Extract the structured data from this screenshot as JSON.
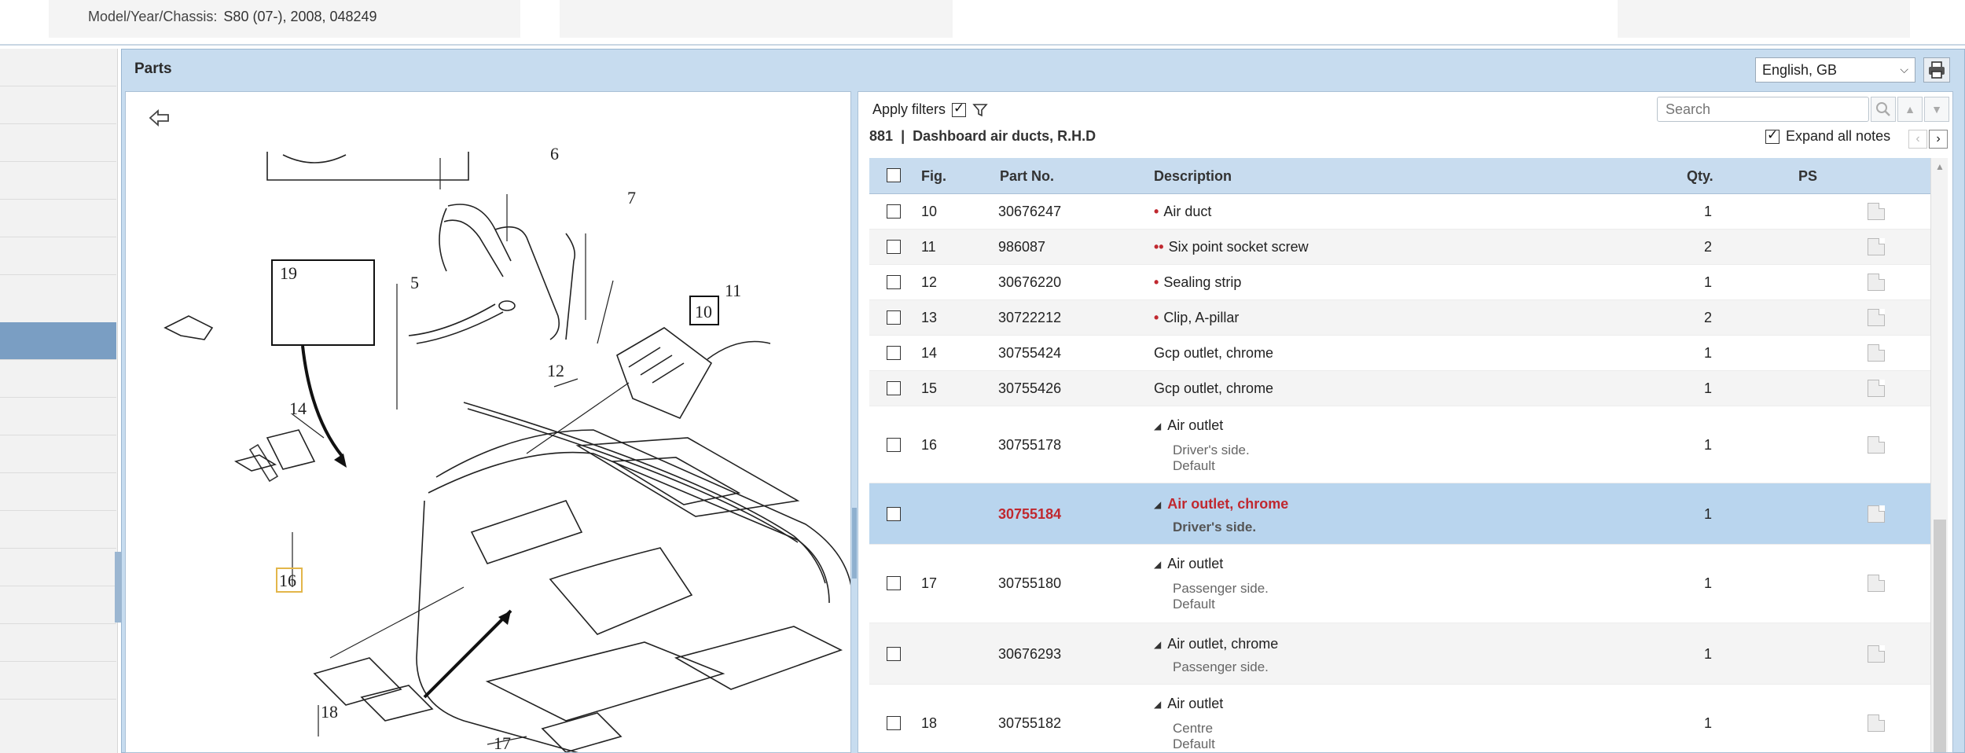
{
  "header": {
    "model_label": "Model/Year/Chassis:",
    "model_value": "S80 (07-), 2008, 048249"
  },
  "parts_panel": {
    "title": "Parts",
    "language": "English, GB"
  },
  "diagram": {
    "callouts": [
      "6",
      "7",
      "19",
      "5",
      "10",
      "11",
      "12",
      "14",
      "16",
      "18",
      "17"
    ]
  },
  "toolbar": {
    "apply_filters_label": "Apply filters",
    "apply_filters_checked": true,
    "group_number": "881",
    "group_separator": "|",
    "group_name": "Dashboard air ducts, R.H.D",
    "search_placeholder": "Search",
    "expand_notes_label": "Expand all notes",
    "expand_notes_checked": true
  },
  "table": {
    "headers": {
      "fig": "Fig.",
      "part_no": "Part No.",
      "description": "Description",
      "qty": "Qty.",
      "ps": "PS"
    },
    "rows": [
      {
        "fig": "10",
        "part_no": "30676247",
        "bullets": "•",
        "description": "Air duct",
        "qty": "1"
      },
      {
        "fig": "11",
        "part_no": "986087",
        "bullets": "••",
        "description": "Six point socket screw",
        "qty": "2"
      },
      {
        "fig": "12",
        "part_no": "30676220",
        "bullets": "•",
        "description": "Sealing strip",
        "qty": "1"
      },
      {
        "fig": "13",
        "part_no": "30722212",
        "bullets": "•",
        "description": "Clip, A-pillar",
        "qty": "2"
      },
      {
        "fig": "14",
        "part_no": "30755424",
        "bullets": "",
        "description": "Gcp outlet, chrome",
        "qty": "1"
      },
      {
        "fig": "15",
        "part_no": "30755426",
        "bullets": "",
        "description": "Gcp outlet, chrome",
        "qty": "1"
      },
      {
        "fig": "16",
        "part_no": "30755178",
        "description": "Air outlet",
        "sub1": "Driver's side.",
        "sub2": "Default",
        "qty": "1"
      },
      {
        "fig": "",
        "part_no": "30755184",
        "description": "Air outlet, chrome",
        "sub1": "Driver's side.",
        "qty": "1",
        "selected": true
      },
      {
        "fig": "17",
        "part_no": "30755180",
        "description": "Air outlet",
        "sub1": "Passenger side.",
        "sub2": "Default",
        "qty": "1"
      },
      {
        "fig": "",
        "part_no": "30676293",
        "description": "Air outlet, chrome",
        "sub1": "Passenger side.",
        "qty": "1"
      },
      {
        "fig": "18",
        "part_no": "30755182",
        "description": "Air outlet",
        "sub1": "Centre",
        "sub2": "Default",
        "qty": "1"
      }
    ]
  },
  "colors": {
    "accent_blue": "#c8dcef",
    "selected_row": "#b9d5ee",
    "bullet_red": "#c0282f",
    "sidebar_active": "#7a9ec3"
  }
}
